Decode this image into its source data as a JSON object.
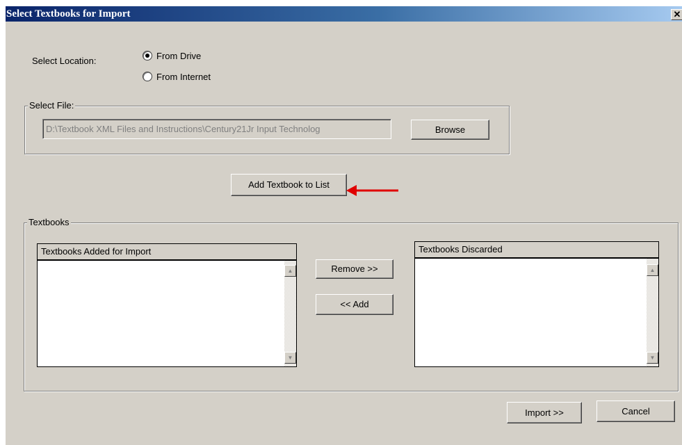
{
  "dialog": {
    "title": "Select Textbooks for Import",
    "close_glyph": "✕"
  },
  "location": {
    "label": "Select Location:",
    "options": [
      {
        "label": "From Drive",
        "selected": true
      },
      {
        "label": "From Internet",
        "selected": false
      }
    ]
  },
  "file": {
    "group_label": "Select File:",
    "path_value": "D:\\Textbook XML Files and Instructions\\Century21Jr Input Technolog",
    "browse_label": "Browse"
  },
  "add_to_list_label": "Add Textbook to List",
  "textbooks": {
    "group_label": "Textbooks",
    "added_header": "Textbooks Added for Import",
    "discarded_header": "Textbooks Discarded",
    "remove_label": "Remove >>",
    "add_label": "<< Add"
  },
  "footer": {
    "import_label": "Import >>",
    "cancel_label": "Cancel"
  },
  "icons": {
    "scroll_up": "▲",
    "scroll_down": "▼",
    "annotation_arrow": "red-arrow-icon"
  },
  "colors": {
    "title_start": "#0a246a",
    "title_end": "#a6caf0",
    "face": "#d4d0c8",
    "annotation": "#e00000"
  }
}
